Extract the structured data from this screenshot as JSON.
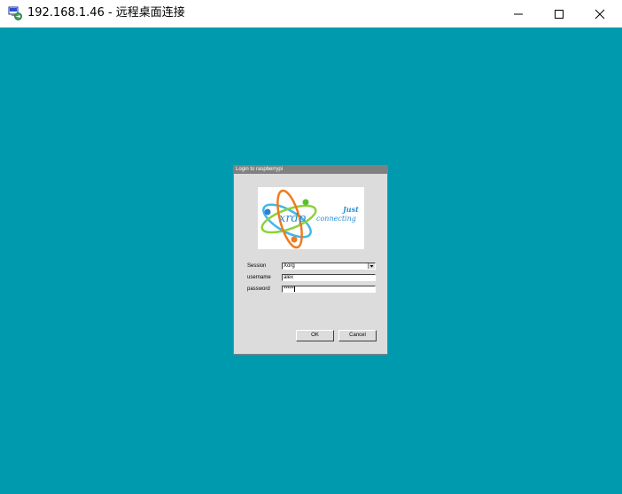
{
  "window": {
    "title": "192.168.1.46 - 远程桌面连接",
    "icon": "remote-desktop-icon",
    "background": "#009aaf"
  },
  "login": {
    "title": "Login to raspberrypi",
    "logo": {
      "brand": "xrdp",
      "tagline_line1": "Just",
      "tagline_line2": "connecting"
    },
    "session_label": "Session",
    "session_value": "Xorg",
    "username_label": "username",
    "username_value": "alex",
    "password_label": "password",
    "password_value": "*****",
    "ok_label": "OK",
    "cancel_label": "Cancel"
  }
}
